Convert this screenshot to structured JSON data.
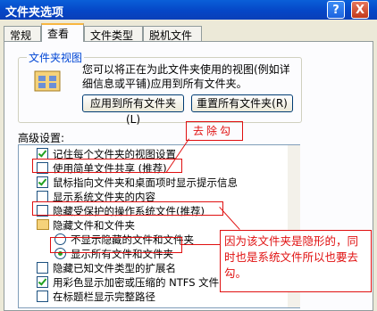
{
  "window": {
    "title": "文件夹选项",
    "help": "?",
    "close": "X"
  },
  "tabs": [
    {
      "label": "常规"
    },
    {
      "label": "查看"
    },
    {
      "label": "文件类型"
    },
    {
      "label": "脱机文件"
    }
  ],
  "folder_view": {
    "group_label": "文件夹视图",
    "description": "您可以将正在为此文件夹使用的视图(例如详细信息或平铺)应用到所有文件夹。",
    "apply_button": "应用到所有文件夹(L)",
    "reset_button": "重置所有文件夹(R)"
  },
  "advanced": {
    "label": "高级设置:",
    "items": [
      {
        "type": "checkbox",
        "checked": true,
        "label": "记住每个文件夹的视图设置"
      },
      {
        "type": "checkbox",
        "checked": false,
        "label": "使用简单文件共享 (推荐)"
      },
      {
        "type": "checkbox",
        "checked": true,
        "label": "鼠标指向文件夹和桌面项时显示提示信息"
      },
      {
        "type": "checkbox",
        "checked": false,
        "label": "显示系统文件夹的内容"
      },
      {
        "type": "checkbox",
        "checked": false,
        "label": "隐藏受保护的操作系统文件(推荐)"
      },
      {
        "type": "folder",
        "label": "隐藏文件和文件夹"
      },
      {
        "type": "radio",
        "checked": false,
        "label": "不显示隐藏的文件和文件夹"
      },
      {
        "type": "radio",
        "checked": true,
        "label": "显示所有文件和文件夹"
      },
      {
        "type": "checkbox",
        "checked": false,
        "label": "隐藏已知文件类型的扩展名"
      },
      {
        "type": "checkbox",
        "checked": true,
        "label": "用彩色显示加密或压缩的 NTFS 文件"
      },
      {
        "type": "checkbox",
        "checked": false,
        "label": "在标题栏显示完整路径"
      }
    ]
  },
  "annotations": {
    "remove_check": "去除勾",
    "note": "因为该文件夹是隐形的，同时也是系统文件所以也要去勾。"
  },
  "colors": {
    "annotation": "#e01010",
    "check": "#21a121",
    "titlebar": "#0546c7"
  }
}
